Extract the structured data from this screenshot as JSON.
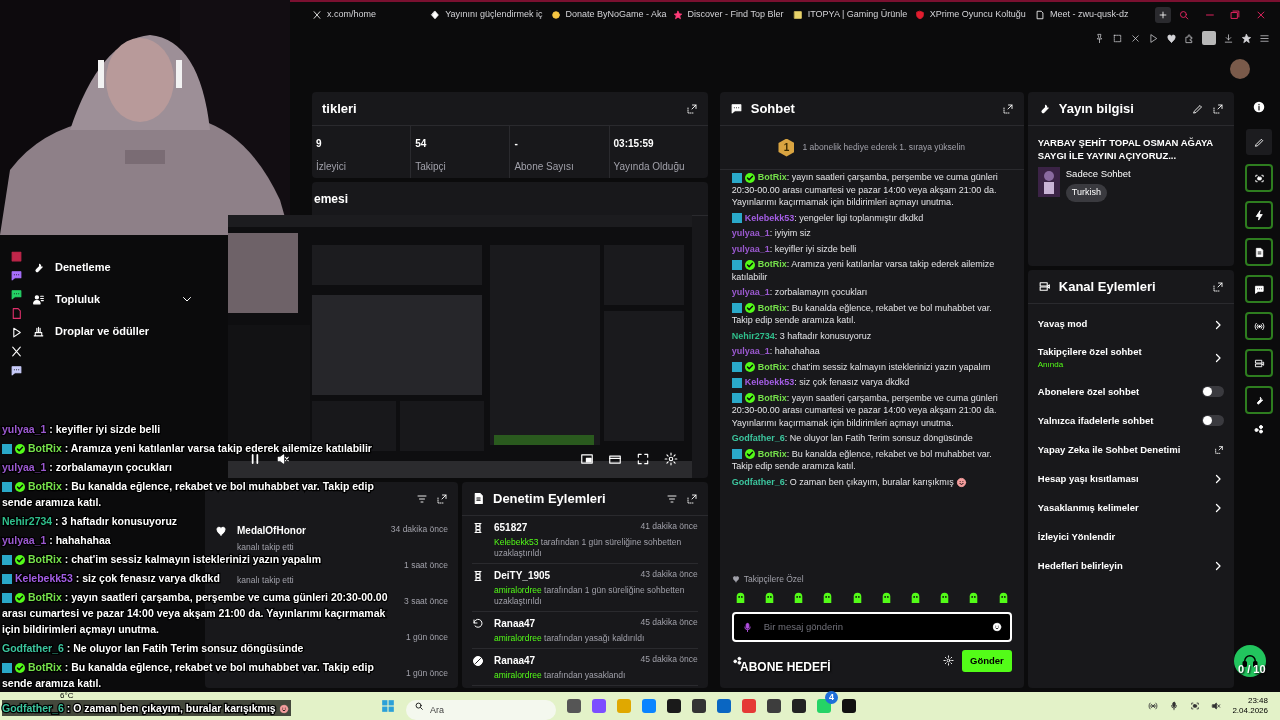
{
  "browser": {
    "tabs": [
      {
        "title": "x.com/home"
      },
      {
        "title": "Yayınını güçlendirmek iç"
      },
      {
        "title": "Donate ByNoGame - Aka"
      },
      {
        "title": "Discover - Find Top Bler"
      },
      {
        "title": "ITOPYA | Gaming Ürünle"
      },
      {
        "title": "XPrime Oyuncu Koltuğu"
      },
      {
        "title": "Meet - zwu-qusk-dz"
      }
    ]
  },
  "sidebar": {
    "items": [
      {
        "label": "Denetleme",
        "expandable": false
      },
      {
        "label": "Topluluk",
        "expandable": true
      },
      {
        "label": "Droplar ve ödüller",
        "expandable": false
      }
    ]
  },
  "stats": {
    "title": "tikleri",
    "items": [
      {
        "value": "9",
        "label": "İzleyici"
      },
      {
        "value": "54",
        "label": "Takipçi"
      },
      {
        "value": "-",
        "label": "Abone Sayısı"
      },
      {
        "value": "03:15:59",
        "label": "Yayında Olduğu"
      }
    ]
  },
  "preview": {
    "title": "emesi"
  },
  "activity": {
    "items": [
      {
        "name": "MedalOfHonor",
        "text": "kanalı takip etti",
        "time": "34 dakika önce"
      },
      {
        "text": "kanalı takip etti",
        "time": "1 saat önce"
      },
      {
        "time": "3 saat önce"
      },
      {
        "time": "1 gün önce"
      },
      {
        "time": "1 gün önce"
      }
    ]
  },
  "moderation": {
    "title": "Denetim Eylemleri",
    "items": [
      {
        "kind": "timeout",
        "target": "651827",
        "actor": "Kelebekk53",
        "text": "tarafından 1 gün süreliğine sohbetten uzaklaştırıldı",
        "time": "41 dakika önce"
      },
      {
        "kind": "timeout",
        "target": "DeiTY_1905",
        "actor": "amiralordree",
        "text": "tarafından 1 gün süreliğine sohbetten uzaklaştırıldı",
        "time": "43 dakika önce"
      },
      {
        "kind": "unban",
        "target": "Ranaa47",
        "actor": "amiralordree",
        "text": "tarafından yasağı kaldırıldı",
        "time": "45 dakika önce"
      },
      {
        "kind": "ban",
        "target": "Ranaa47",
        "actor": "amiralordree",
        "text": "tarafından yasaklandı",
        "time": "45 dakika önce"
      }
    ]
  },
  "chat": {
    "title": "Sohbet",
    "separator": ":",
    "pinned": {
      "rank": "1",
      "text": "1 abonelik hediye ederek 1. sıraya yükselin"
    },
    "messages": [
      {
        "user": "BotRix",
        "color": "#75e04b",
        "moderator": true,
        "verified": true,
        "text": "yayın saatleri çarşamba, perşembe ve cuma günleri 20:30-00.00 arası cumartesi ve pazar 14:00 veya akşam 21:00 da. Yayınlarımı kaçırmamak için bildirimleri açmayı unutma."
      },
      {
        "user": "Kelebekk53",
        "color": "#a45ee5",
        "moderator": true,
        "verified": false,
        "text": "yengeler ligi toplanmıştır dkdkd"
      },
      {
        "user": "yulyaa_1",
        "color": "#9b59d0",
        "moderator": false,
        "verified": false,
        "text": "iyiyim siz"
      },
      {
        "user": "yulyaa_1",
        "color": "#9b59d0",
        "moderator": false,
        "verified": false,
        "text": "keyifler iyi sizde belli"
      },
      {
        "user": "BotRix",
        "color": "#75e04b",
        "moderator": true,
        "verified": true,
        "text": "Aramıza yeni katılanlar varsa takip ederek ailemize katılabilir"
      },
      {
        "user": "yulyaa_1",
        "color": "#9b59d0",
        "moderator": false,
        "verified": false,
        "text": "zorbalamayın çocukları"
      },
      {
        "user": "BotRix",
        "color": "#75e04b",
        "moderator": true,
        "verified": true,
        "text": "Bu kanalda eğlence, rekabet ve bol muhabbet var. Takip edip sende aramıza katıl."
      },
      {
        "user": "Nehir2734",
        "color": "#2fbf8c",
        "moderator": false,
        "verified": false,
        "text": "3 haftadır konusuyoruz"
      },
      {
        "user": "yulyaa_1",
        "color": "#9b59d0",
        "moderator": false,
        "verified": false,
        "text": "hahahahaa"
      },
      {
        "user": "BotRix",
        "color": "#75e04b",
        "moderator": true,
        "verified": true,
        "text": "chat'im sessiz kalmayın isteklerinizi yazın yapalım"
      },
      {
        "user": "Kelebekk53",
        "color": "#a45ee5",
        "moderator": true,
        "verified": false,
        "text": "siz çok fenasız varya dkdkd"
      },
      {
        "user": "BotRix",
        "color": "#75e04b",
        "moderator": true,
        "verified": true,
        "text": "yayın saatleri çarşamba, perşembe ve cuma günleri 20:30-00.00 arası cumartesi ve pazar 14:00 veya akşam 21:00 da. Yayınlarımı kaçırmamak için bildirimleri açmayı unutma."
      },
      {
        "user": "Godfather_6",
        "color": "#3cc59e",
        "moderator": false,
        "verified": false,
        "text": "Ne oluyor lan Fatih Terim sonsuz döngüsünde"
      },
      {
        "user": "BotRix",
        "color": "#75e04b",
        "moderator": true,
        "verified": true,
        "text": "Bu kanalda eğlence, rekabet ve bol muhabbet var. Takip edip sende aramıza katıl."
      },
      {
        "user": "Godfather_6",
        "color": "#3cc59e",
        "moderator": false,
        "verified": false,
        "text": "O zaman ben çıkayım, buralar karışıkmış",
        "emoji": true
      }
    ],
    "emote_label": "Takipçilere Özel",
    "input": {
      "placeholder": "Bir mesaj gönderin"
    },
    "send": "Gönder"
  },
  "stream_info": {
    "title": "Yayın bilgisi",
    "stream_title": "YARBAY ŞEHİT TOPAL OSMAN AĞAYA SAYGI İLE YAYINI AÇIYORUZ...",
    "category": "Sadece Sohbet",
    "tag": "Turkish"
  },
  "channel_actions": {
    "title": "Kanal Eylemleri",
    "items": [
      {
        "label": "Yavaş mod",
        "kind": "link"
      },
      {
        "label": "Takipçilere özel sohbet",
        "sublabel": "Anında",
        "kind": "link"
      },
      {
        "label": "Abonelere özel sohbet",
        "kind": "toggle",
        "on": false
      },
      {
        "label": "Yalnızca ifadelerle sohbet",
        "kind": "toggle",
        "on": false
      },
      {
        "label": "Yapay Zeka ile Sohbet Denetimi",
        "kind": "external"
      },
      {
        "label": "Hesap yaşı kısıtlaması",
        "kind": "link"
      },
      {
        "label": "Yasaklanmış kelimeler",
        "kind": "link"
      },
      {
        "label": "İzleyici Yönlendir",
        "kind": "plain"
      },
      {
        "label": "Hedefleri belirleyin",
        "kind": "link"
      }
    ]
  },
  "stream_overlay": {
    "separator": ":",
    "chat": [
      {
        "user": "yulyaa_1",
        "color": "#9b59d0",
        "moderator": false,
        "verified": false,
        "text": "keyifler iyi sizde belli"
      },
      {
        "user": "BotRix",
        "color": "#75e04b",
        "moderator": true,
        "verified": true,
        "text": "Aramıza yeni katılanlar varsa takip ederek ailemize katılabilir"
      },
      {
        "user": "yulyaa_1",
        "color": "#9b59d0",
        "moderator": false,
        "verified": false,
        "text": "zorbalamayın çocukları"
      },
      {
        "user": "BotRix",
        "color": "#75e04b",
        "moderator": true,
        "verified": true,
        "text": "Bu kanalda eğlence, rekabet ve bol muhabbet var. Takip edip sende aramıza katıl."
      },
      {
        "user": "Nehir2734",
        "color": "#2fbf8c",
        "moderator": false,
        "verified": false,
        "text": "3 haftadır konusuyoruz"
      },
      {
        "user": "yulyaa_1",
        "color": "#9b59d0",
        "moderator": false,
        "verified": false,
        "text": "hahahahaa"
      },
      {
        "user": "BotRix",
        "color": "#75e04b",
        "moderator": true,
        "verified": true,
        "text": "chat'im sessiz kalmayın isteklerinizi yazın yapalım"
      },
      {
        "user": "Kelebekk53",
        "color": "#a45ee5",
        "moderator": true,
        "verified": false,
        "text": "siz çok fenasız varya dkdkd"
      },
      {
        "user": "BotRix",
        "color": "#75e04b",
        "moderator": true,
        "verified": true,
        "text": "yayın saatleri çarşamba, perşembe ve cuma günleri 20:30-00.00 arası cumartesi ve pazar 14:00 veya akşam 21:00 da. Yayınlarımı kaçırmamak için bildirimleri açmayı unutma."
      },
      {
        "user": "Godfather_6",
        "color": "#3cc59e",
        "moderator": false,
        "verified": false,
        "text": "Ne oluyor lan Fatih Terim sonsuz döngüsünde"
      },
      {
        "user": "BotRix",
        "color": "#75e04b",
        "moderator": true,
        "verified": true,
        "text": "Bu kanalda eğlence, rekabet ve bol muhabbet var. Takip edip sende aramıza katıl."
      },
      {
        "user": "Godfather_6",
        "color": "#3cc59e",
        "moderator": false,
        "verified": false,
        "text": "O zaman ben çıkayım, buralar karışıkmış",
        "emoji": true
      }
    ],
    "goal": "ABONE HEDEFİ",
    "counter": "0 / 10"
  },
  "taskbar": {
    "weather": "6°C",
    "search_placeholder": "Ara",
    "notification_count": "4",
    "time": "23:48",
    "date": "2.04.2026"
  }
}
